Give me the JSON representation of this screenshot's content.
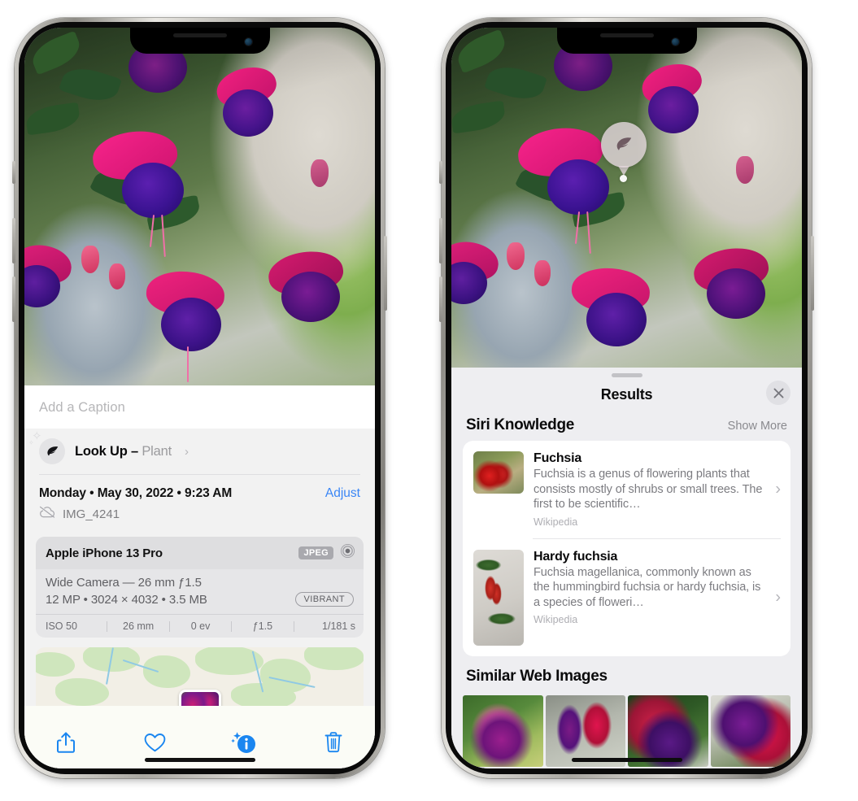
{
  "left_phone": {
    "caption_placeholder": "Add a Caption",
    "lookup": {
      "label": "Look Up",
      "dash": " – ",
      "kind": "Plant",
      "chevron": "›",
      "icon": "leaf-icon"
    },
    "metadata": {
      "date_line": "Monday • May 30, 2022 • 9:23 AM",
      "adjust_label": "Adjust",
      "filename": "IMG_4241",
      "cloud_icon": "cloud-slash-icon"
    },
    "camera_card": {
      "model": "Apple iPhone 13 Pro",
      "format_badge": "JPEG",
      "lens_icon": "aperture-icon",
      "lens_line": "Wide Camera — 26 mm ƒ1.5",
      "specs_line": "12 MP • 3024 × 4032 • 3.5 MB",
      "style_badge": "VIBRANT",
      "exif": [
        "ISO 50",
        "26 mm",
        "0 ev",
        "ƒ1.5",
        "1/181 s"
      ]
    },
    "toolbar": {
      "share_label": "share-icon",
      "favorite_label": "heart-icon",
      "info_label": "info-sparkle-icon",
      "delete_label": "trash-icon"
    },
    "accent_color": "#3a86f6"
  },
  "right_phone": {
    "visual_lookup_badge": "leaf-icon",
    "sheet": {
      "title": "Results",
      "close_icon": "close-icon"
    },
    "siri_knowledge": {
      "section_title": "Siri Knowledge",
      "show_more": "Show More",
      "items": [
        {
          "title": "Fuchsia",
          "description": "Fuchsia is a genus of flowering plants that consists mostly of shrubs or small trees. The first to be scientific…",
          "source": "Wikipedia",
          "chevron": "›"
        },
        {
          "title": "Hardy fuchsia",
          "description": "Fuchsia magellanica, commonly known as the hummingbird fuchsia or hardy fuchsia, is a species of floweri…",
          "source": "Wikipedia",
          "chevron": "›"
        }
      ]
    },
    "similar_web_images": {
      "section_title": "Similar Web Images",
      "thumbnails": [
        "fuchsia-thumb-1",
        "fuchsia-thumb-2",
        "fuchsia-thumb-3",
        "fuchsia-thumb-4"
      ]
    }
  }
}
